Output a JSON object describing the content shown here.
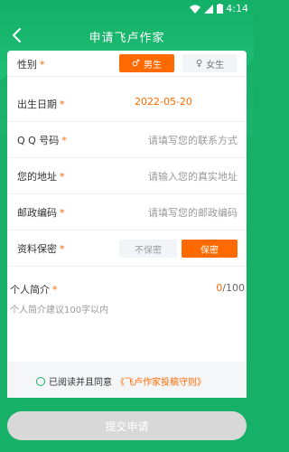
{
  "status_bar": {
    "time": "4:14"
  },
  "nav": {
    "title": "申请飞卢作家"
  },
  "form": {
    "gender": {
      "label": "性别",
      "star": "*",
      "male": "男生",
      "female": "女生",
      "selected": "male"
    },
    "birthday": {
      "label": "出生日期",
      "star": "*",
      "value": "2022-05-20"
    },
    "qq": {
      "label": "Q Q 号码",
      "star": "*",
      "placeholder": "请填写您的联系方式"
    },
    "address": {
      "label": "您的地址",
      "star": "*",
      "placeholder": "请输入您的真实地址"
    },
    "postcode": {
      "label": "邮政编码",
      "star": "*",
      "placeholder": "请填写您的邮政编码"
    },
    "privacy": {
      "label": "资料保密",
      "star": "*",
      "no_secret": "不保密",
      "secret": "保密",
      "selected": "secret"
    },
    "intro": {
      "label": "个人简介",
      "star": "*",
      "count_current": "0",
      "count_max": "/100",
      "placeholder": "个人简介建议100字以内"
    }
  },
  "agreement": {
    "prefix": "已阅读并且同意",
    "link": "《飞卢作家投稿守则》"
  },
  "submit": {
    "label": "提交申请"
  },
  "colors": {
    "primary_green": "#17b067",
    "accent_orange": "#ff6a00",
    "disabled_gray": "#d8d8d8"
  }
}
